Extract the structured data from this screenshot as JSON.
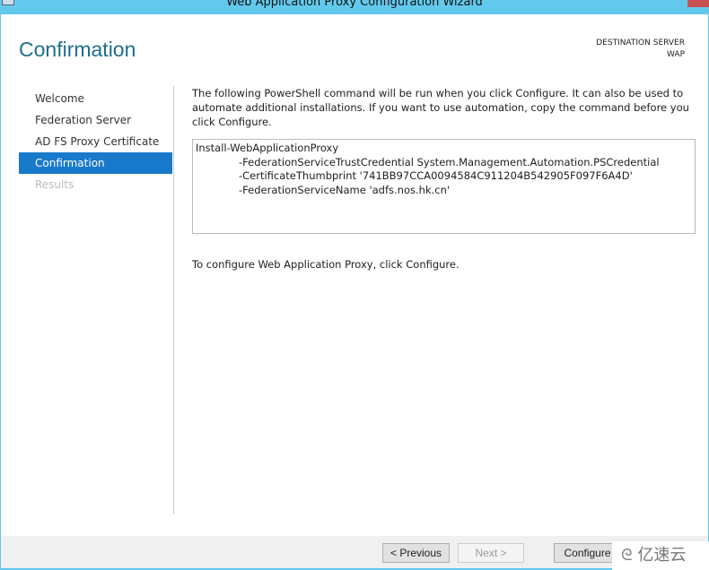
{
  "window": {
    "title": "Web Application Proxy Configuration Wizard"
  },
  "header": {
    "title": "Confirmation",
    "dest_label": "DESTINATION SERVER",
    "dest_value": "WAP"
  },
  "nav": {
    "items": [
      {
        "label": "Welcome"
      },
      {
        "label": "Federation Server"
      },
      {
        "label": "AD FS Proxy Certificate"
      },
      {
        "label": "Confirmation"
      },
      {
        "label": "Results"
      }
    ]
  },
  "main": {
    "intro": "The following PowerShell command will be run when you click Configure. It can also be used to automate additional installations. If you want to use automation, copy the command before you click Configure.",
    "command": [
      "Install-WebApplicationProxy",
      "-FederationServiceTrustCredential System.Management.Automation.PSCredential",
      "-CertificateThumbprint '741BB97CCA0094584C911204B542905F097F6A4D'",
      "-FederationServiceName 'adfs.nos.hk.cn'"
    ],
    "hint": "To configure Web Application Proxy, click Configure."
  },
  "footer": {
    "previous": "< Previous",
    "next": "Next >",
    "configure": "Configure"
  },
  "watermark": "亿速云"
}
